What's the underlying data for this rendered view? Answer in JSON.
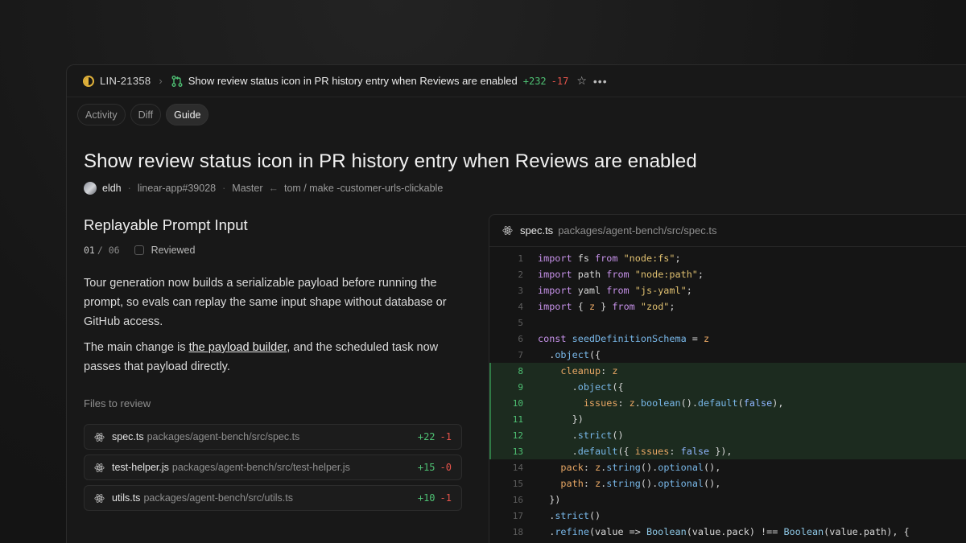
{
  "topbar": {
    "issue_id": "LIN-21358",
    "pr_title": "Show review status icon in PR history entry when Reviews are enabled",
    "additions": "+232",
    "deletions": "-17"
  },
  "tabs": [
    {
      "label": "Activity",
      "active": false
    },
    {
      "label": "Diff",
      "active": false
    },
    {
      "label": "Guide",
      "active": true
    }
  ],
  "page": {
    "title": "Show review status icon in PR history entry when Reviews are enabled",
    "author": "eldh",
    "repo_ref": "linear-app#39028",
    "base_branch": "Master",
    "head_branch": "tom / make -customer-urls-clickable"
  },
  "guide": {
    "section_title": "Replayable Prompt Input",
    "step_current": "01",
    "step_total": "/ 06",
    "reviewed_label": "Reviewed",
    "paragraph_1": "Tour generation now builds a serializable payload before running the prompt, so evals can replay the same input shape without database or GitHub access.",
    "paragraph_2_before": "The main change is ",
    "paragraph_2_link": "the payload builder",
    "paragraph_2_after": ", and the scheduled task now passes that payload directly.",
    "files_label": "Files to review",
    "files": [
      {
        "name": "spec.ts",
        "path": "packages/agent-bench/src/spec.ts",
        "additions": "+22",
        "deletions": "-1"
      },
      {
        "name": "test-helper.js",
        "path": "packages/agent-bench/src/test-helper.js",
        "additions": "+15",
        "deletions": "-0"
      },
      {
        "name": "utils.ts",
        "path": "packages/agent-bench/src/utils.ts",
        "additions": "+10",
        "deletions": "-1"
      }
    ]
  },
  "code": {
    "file_name": "spec.ts",
    "file_path": "packages/agent-bench/src/spec.ts",
    "highlighted_lines": [
      8,
      9,
      10,
      11,
      12,
      13
    ],
    "lines": [
      "import fs from \"node:fs\";",
      "import path from \"node:path\";",
      "import yaml from \"js-yaml\";",
      "import { z } from \"zod\";",
      "",
      "const seedDefinitionSchema = z",
      "  .object({",
      "    cleanup: z",
      "      .object({",
      "        issues: z.boolean().default(false),",
      "      })",
      "      .strict()",
      "      .default({ issues: false }),",
      "    pack: z.string().optional(),",
      "    path: z.string().optional(),",
      "  })",
      "  .strict()",
      "  .refine(value => Boolean(value.pack) !== Boolean(value.path), {"
    ]
  },
  "colors": {
    "additions": "#4ec073",
    "deletions": "#e5534b",
    "in_progress": "#e0b13a"
  },
  "icons": [
    "in-progress-icon",
    "chevron-right-icon",
    "pull-request-icon",
    "star-icon",
    "more-icon",
    "react-file-icon"
  ]
}
